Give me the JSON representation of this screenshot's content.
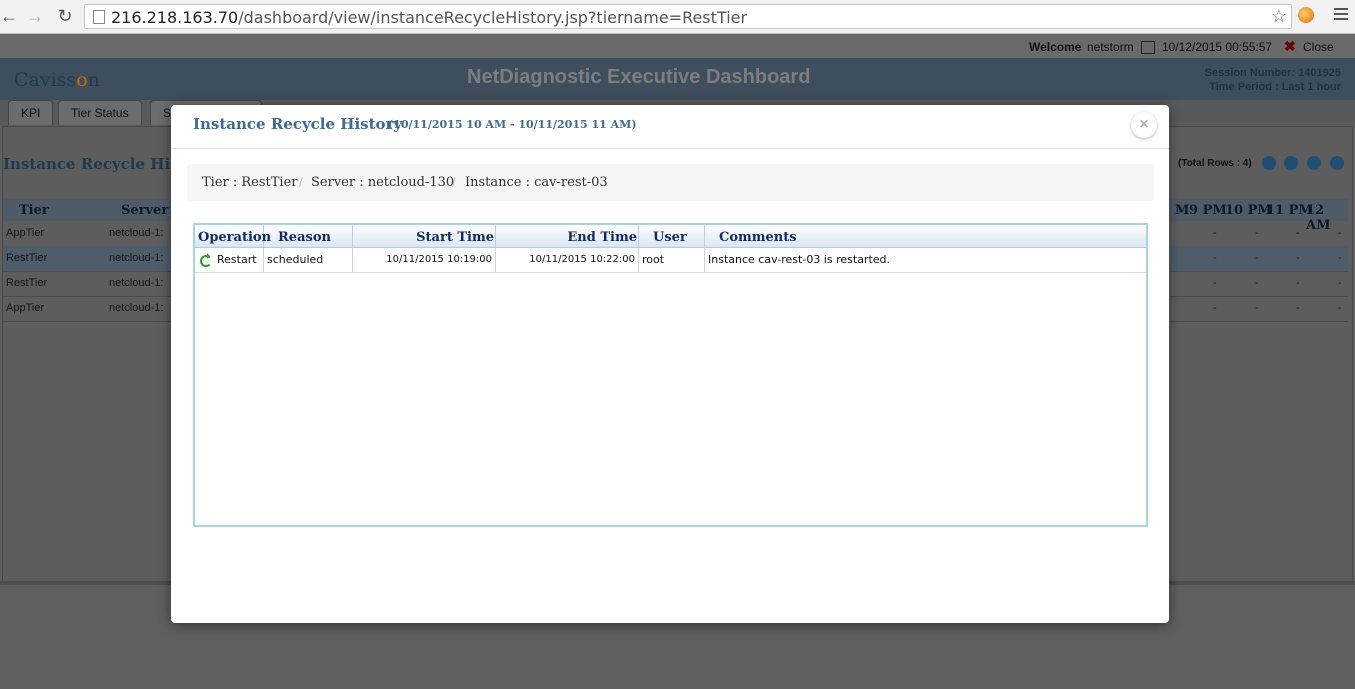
{
  "browser": {
    "url_host": "216.218.163.70",
    "url_path": "/dashboard/view/instanceRecycleHistory.jsp?tiername=RestTier"
  },
  "dashboard": {
    "welcome_label": "Welcome",
    "user": "netstorm",
    "datetime": "10/12/2015 00:55:57",
    "close_label": "Close",
    "logo": "Caviss",
    "logo_o": "o",
    "logo_end": "n",
    "title": "NetDiagnostic Executive Dashboard",
    "session_number": "Session Number: 1401925",
    "time_period": "Time Period : Last 1 hour",
    "tabs": [
      "KPI",
      "Tier Status",
      "S"
    ],
    "page_heading": "Instance Recycle Histo",
    "total_rows": "(Total Rows : 4)",
    "columns": {
      "tier": "Tier",
      "server": "Server",
      "h1": "M",
      "h2": "9 PM",
      "h3": "10 PM",
      "h4": "11 PM",
      "h5": "12 AM"
    },
    "rows": [
      {
        "tier": "AppTier",
        "server": "netcloud-1:",
        "dash": "-"
      },
      {
        "tier": "RestTier",
        "server": "netcloud-1:",
        "dash": "-"
      },
      {
        "tier": "RestTier",
        "server": "netcloud-1:",
        "dash": "-"
      },
      {
        "tier": "AppTier",
        "server": "netcloud-1:",
        "dash": "-"
      }
    ]
  },
  "modal": {
    "title": "Instance Recycle History",
    "range": "(10/11/2015 10 AM - 10/11/2015 11 AM)",
    "close_symbol": "×",
    "breadcrumb": {
      "tier": "Tier : RestTier",
      "server": "Server : netcloud-130",
      "instance": "Instance : cav-rest-03",
      "sep": "/"
    },
    "columns": {
      "operation": "Operation",
      "reason": "Reason",
      "start_time": "Start Time",
      "end_time": "End Time",
      "user": "User",
      "comments": "Comments"
    },
    "rows": [
      {
        "operation": "Restart",
        "reason": "scheduled",
        "start_time": "10/11/2015 10:19:00",
        "end_time": "10/11/2015 10:22:00",
        "user": "root",
        "comments": "Instance cav-rest-03 is restarted."
      }
    ]
  }
}
